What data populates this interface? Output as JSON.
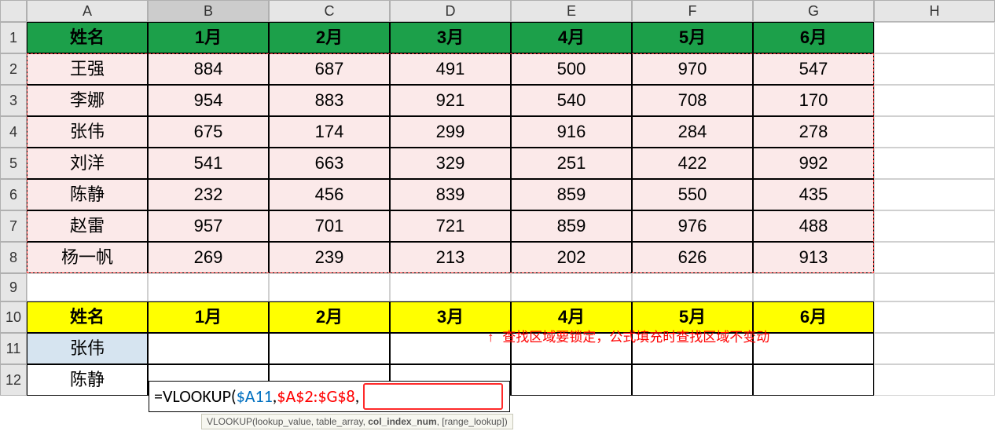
{
  "cols": [
    "A",
    "B",
    "C",
    "D",
    "E",
    "F",
    "G",
    "H"
  ],
  "rows": [
    "1",
    "2",
    "3",
    "4",
    "5",
    "6",
    "7",
    "8",
    "9",
    "10",
    "11",
    "12"
  ],
  "selected_col": "B",
  "header1": [
    "姓名",
    "1月",
    "2月",
    "3月",
    "4月",
    "5月",
    "6月"
  ],
  "data1": [
    {
      "name": "王强",
      "v": [
        884,
        687,
        491,
        500,
        970,
        547
      ]
    },
    {
      "name": "李娜",
      "v": [
        954,
        883,
        921,
        540,
        708,
        170
      ]
    },
    {
      "name": "张伟",
      "v": [
        675,
        174,
        299,
        916,
        284,
        278
      ]
    },
    {
      "name": "刘洋",
      "v": [
        541,
        663,
        329,
        251,
        422,
        992
      ]
    },
    {
      "name": "陈静",
      "v": [
        232,
        456,
        839,
        859,
        550,
        435
      ]
    },
    {
      "name": "赵雷",
      "v": [
        957,
        701,
        721,
        859,
        976,
        488
      ]
    },
    {
      "name": "杨一帆",
      "v": [
        269,
        239,
        213,
        202,
        626,
        913
      ]
    }
  ],
  "header2": [
    "姓名",
    "1月",
    "2月",
    "3月",
    "4月",
    "5月",
    "6月"
  ],
  "lookup_names": [
    "张伟",
    "陈静"
  ],
  "formula": {
    "prefix": "=VLOOKUP(",
    "arg1": "$A11",
    "sep": ",",
    "arg2": "$A$2:$G$8",
    "suffix": ","
  },
  "tooltip": {
    "fn": "VLOOKUP(",
    "p1": "lookup_value",
    "p2": "table_array",
    "p3": "col_index_num",
    "p4": "[range_lookup]",
    "end": ")"
  },
  "annotation": "查找区域要锁定，公式填充时查找区域不变动",
  "arrow": "↑"
}
